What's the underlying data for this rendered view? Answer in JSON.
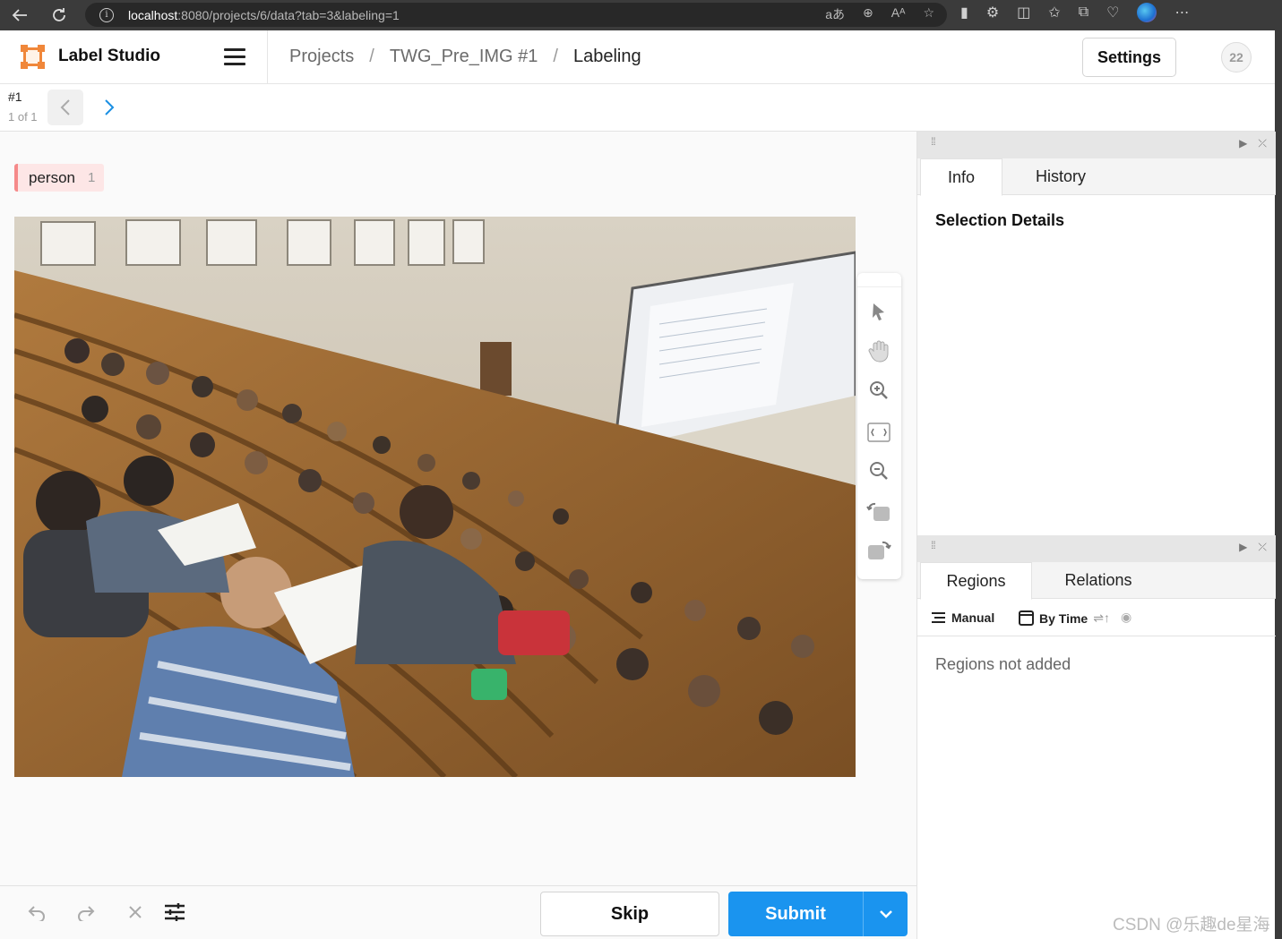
{
  "browser": {
    "url_host": "localhost",
    "url_rest": ":8080/projects/6/data?tab=3&labeling=1"
  },
  "header": {
    "app_title": "Label Studio",
    "breadcrumb": [
      "Projects",
      "TWG_Pre_IMG #1",
      "Labeling"
    ],
    "breadcrumb_sep": "/",
    "settings_label": "Settings",
    "avatar_count": "22"
  },
  "task": {
    "id": "#1",
    "count": "1 of 1"
  },
  "labels": [
    {
      "name": "person",
      "hotkey": "1",
      "color": "#f58a8a"
    }
  ],
  "side": {
    "top_tabs": [
      "Info",
      "History"
    ],
    "selection_title": "Selection Details",
    "bottom_tabs": [
      "Regions",
      "Relations"
    ],
    "sort_manual": "Manual",
    "sort_by_time": "By Time",
    "empty_text": "Regions not added"
  },
  "footer": {
    "skip_label": "Skip",
    "submit_label": "Submit"
  },
  "watermark": "CSDN @乐趣de星海",
  "colors": {
    "accent": "#1a94ef",
    "logo": "#f0873a"
  }
}
